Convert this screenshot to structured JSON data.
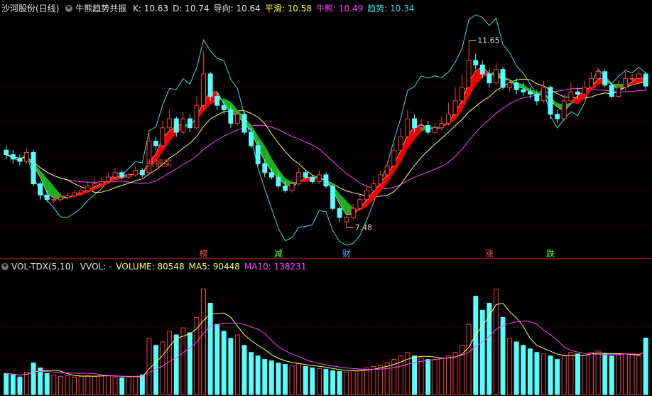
{
  "header": {
    "stock": "沙河股份(日线)",
    "indicator": "牛熊趋势共振",
    "items": [
      {
        "label": "K:",
        "value": "10.63",
        "color": "#e6e6e6"
      },
      {
        "label": "D:",
        "value": "10.74",
        "color": "#e6e6e6"
      },
      {
        "label": "导向:",
        "value": "10.64",
        "color": "#e6e6e6"
      },
      {
        "label": "平滑:",
        "value": "10.58",
        "color": "#ffff55"
      },
      {
        "label": "牛熊:",
        "value": "10.49",
        "color": "#ff44ff"
      },
      {
        "label": "趋势:",
        "value": "10.34",
        "color": "#44dddd"
      }
    ]
  },
  "vol_header": {
    "name": "VOL-TDX(5,10)",
    "items": [
      {
        "label": "VVOL: -",
        "value": "",
        "color": "#e6e6e6"
      },
      {
        "label": "VOLUME:",
        "value": "80548",
        "color": "#ffff55"
      },
      {
        "label": "MA5:",
        "value": "90448",
        "color": "#ffff55"
      },
      {
        "label": "MA10:",
        "value": "138231",
        "color": "#ff44ff"
      }
    ]
  },
  "colors": {
    "up": "#ff3b3b",
    "down": "#55ffff",
    "ma_yellow": "#ffff55",
    "ma_magenta": "#ff44ff",
    "trend_cyan": "#44dddd",
    "grid": "#7a0000",
    "bull_band": "#ff0000",
    "bear_band": "#22bb22"
  },
  "chart_data": {
    "type": "candlestick",
    "price_range": [
      7.0,
      12.2
    ],
    "volume_range": [
      0,
      175000
    ],
    "annotations": [
      {
        "text": "11.65",
        "index": 68,
        "price": 11.65
      },
      {
        "text": "7.48",
        "index": 50,
        "price": 7.48
      },
      {
        "text": "共振买",
        "index": 20,
        "price": 8.9
      }
    ],
    "markers": [
      {
        "text": "榜",
        "index": 29,
        "color": "#ff5555"
      },
      {
        "text": "减",
        "index": 40,
        "color": "#55ff55"
      },
      {
        "text": "财",
        "index": 50,
        "color": "#55aaff"
      },
      {
        "text": "涨",
        "index": 71,
        "color": "#ff5555"
      },
      {
        "text": "跌",
        "index": 80,
        "color": "#55ff55"
      }
    ],
    "close": [
      9.1,
      9.0,
      8.95,
      9.15,
      8.45,
      8.2,
      8.1,
      8.1,
      8.15,
      8.18,
      8.25,
      8.3,
      8.4,
      8.45,
      8.5,
      8.6,
      8.7,
      8.6,
      8.65,
      8.75,
      8.65,
      9.4,
      9.3,
      9.7,
      9.9,
      9.6,
      9.9,
      9.7,
      10.2,
      10.9,
      10.4,
      10.2,
      10.1,
      9.8,
      10.0,
      9.6,
      9.3,
      8.9,
      8.7,
      8.6,
      8.4,
      8.3,
      8.45,
      8.7,
      8.6,
      8.5,
      8.65,
      8.4,
      7.9,
      7.7,
      7.7,
      7.9,
      8.1,
      8.3,
      8.45,
      8.65,
      8.85,
      9.2,
      9.5,
      9.9,
      9.7,
      9.75,
      9.6,
      9.7,
      9.8,
      10.0,
      10.3,
      10.6,
      11.2,
      11.1,
      10.9,
      10.7,
      11.0,
      10.6,
      10.7,
      10.55,
      10.5,
      10.45,
      10.3,
      10.6,
      10.0,
      9.9,
      10.3,
      10.5,
      10.45,
      10.6,
      10.8,
      10.95,
      10.65,
      10.4,
      10.6,
      10.8,
      10.8,
      10.9,
      10.63
    ],
    "open": [
      9.2,
      9.1,
      9.0,
      8.95,
      9.15,
      8.45,
      8.2,
      8.1,
      8.1,
      8.15,
      8.18,
      8.25,
      8.3,
      8.4,
      8.45,
      8.5,
      8.6,
      8.7,
      8.6,
      8.65,
      8.75,
      8.7,
      9.4,
      9.3,
      9.7,
      9.9,
      9.6,
      9.9,
      9.7,
      10.2,
      10.9,
      10.4,
      10.2,
      10.1,
      9.8,
      10.0,
      9.6,
      9.3,
      8.9,
      8.7,
      8.6,
      8.4,
      8.3,
      8.45,
      8.7,
      8.6,
      8.5,
      8.65,
      8.4,
      7.9,
      7.6,
      7.7,
      7.9,
      8.1,
      8.3,
      8.45,
      8.65,
      8.85,
      9.2,
      9.5,
      9.9,
      9.7,
      9.75,
      9.6,
      9.7,
      9.8,
      10.0,
      10.3,
      10.6,
      11.2,
      11.1,
      10.9,
      10.7,
      11.0,
      10.6,
      10.7,
      10.55,
      10.5,
      10.45,
      10.3,
      10.6,
      10.0,
      9.9,
      10.3,
      10.5,
      10.45,
      10.6,
      10.8,
      10.95,
      10.65,
      10.4,
      10.6,
      10.8,
      10.8,
      10.9
    ],
    "high": [
      9.3,
      9.2,
      9.1,
      9.25,
      9.2,
      8.5,
      8.3,
      8.2,
      8.25,
      8.25,
      8.3,
      8.35,
      8.5,
      8.55,
      8.6,
      8.7,
      8.8,
      8.75,
      8.7,
      8.85,
      8.8,
      9.6,
      9.5,
      9.85,
      10.1,
      9.95,
      10.05,
      10.0,
      10.4,
      11.4,
      10.95,
      10.5,
      10.3,
      10.2,
      10.1,
      10.05,
      9.7,
      9.4,
      9.0,
      8.8,
      8.7,
      8.5,
      8.55,
      8.8,
      8.75,
      8.65,
      8.75,
      8.7,
      8.45,
      7.95,
      7.85,
      8.0,
      8.2,
      8.4,
      8.55,
      8.75,
      8.95,
      9.35,
      9.7,
      10.1,
      10.0,
      9.9,
      9.85,
      9.8,
      9.95,
      10.25,
      10.6,
      10.9,
      11.65,
      11.35,
      11.2,
      11.0,
      11.15,
      11.05,
      10.8,
      10.8,
      10.7,
      10.6,
      10.55,
      10.75,
      10.65,
      10.1,
      10.45,
      10.7,
      10.6,
      10.75,
      10.95,
      11.05,
      11.0,
      10.7,
      10.75,
      10.95,
      10.9,
      11.0,
      10.95
    ],
    "low": [
      9.0,
      8.9,
      8.85,
      8.9,
      8.4,
      8.1,
      8.05,
      8.0,
      8.05,
      8.1,
      8.15,
      8.2,
      8.25,
      8.35,
      8.4,
      8.45,
      8.55,
      8.55,
      8.55,
      8.6,
      8.6,
      8.65,
      9.2,
      9.25,
      9.6,
      9.5,
      9.55,
      9.6,
      9.65,
      10.1,
      10.3,
      10.1,
      10.0,
      9.7,
      9.75,
      9.55,
      9.25,
      8.85,
      8.6,
      8.55,
      8.35,
      8.25,
      8.25,
      8.4,
      8.55,
      8.45,
      8.45,
      8.35,
      7.85,
      7.6,
      7.48,
      7.65,
      7.85,
      8.05,
      8.25,
      8.4,
      8.6,
      8.8,
      9.15,
      9.45,
      9.6,
      9.65,
      9.55,
      9.55,
      9.65,
      9.75,
      9.95,
      10.25,
      10.55,
      11.0,
      10.8,
      10.6,
      10.65,
      10.55,
      10.5,
      10.45,
      10.4,
      10.35,
      10.2,
      10.25,
      9.9,
      9.8,
      9.85,
      10.25,
      10.35,
      10.4,
      10.55,
      10.75,
      10.6,
      10.35,
      10.35,
      10.55,
      10.7,
      10.75,
      10.55
    ],
    "volume": [
      30000,
      28000,
      25000,
      32000,
      45000,
      38000,
      30000,
      28000,
      26000,
      27000,
      25000,
      26000,
      27000,
      26000,
      28000,
      27000,
      25000,
      24000,
      25000,
      26000,
      28000,
      80000,
      70000,
      75000,
      90000,
      85000,
      95000,
      88000,
      110000,
      150000,
      130000,
      100000,
      90000,
      80000,
      85000,
      70000,
      60000,
      55000,
      50000,
      48000,
      45000,
      43000,
      42000,
      44000,
      40000,
      38000,
      37000,
      36000,
      34000,
      33000,
      32000,
      34000,
      36000,
      38000,
      40000,
      42000,
      45000,
      50000,
      55000,
      60000,
      55000,
      52000,
      50000,
      50000,
      52000,
      55000,
      60000,
      70000,
      100000,
      140000,
      120000,
      130000,
      150000,
      110000,
      80000,
      75000,
      70000,
      65000,
      60000,
      58000,
      55000,
      50000,
      55000,
      60000,
      58000,
      56000,
      60000,
      62000,
      58000,
      55000,
      56000,
      58000,
      57000,
      55000,
      80548
    ]
  }
}
